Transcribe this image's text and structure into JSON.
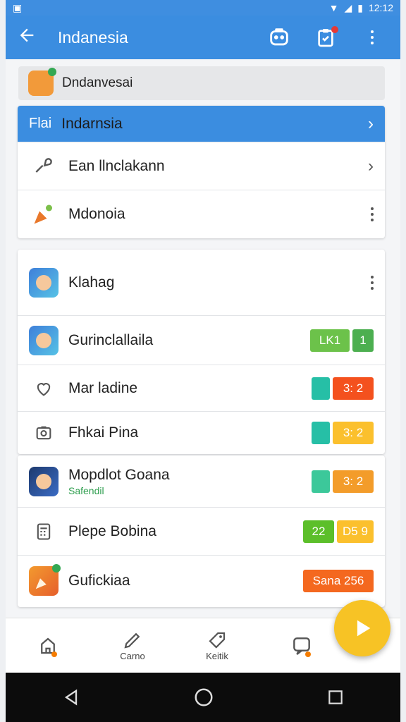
{
  "status_bar": {
    "time": "12:12"
  },
  "app_bar": {
    "title": "Indanesia",
    "back_icon": "arrow-left-icon",
    "actions": [
      "robot-icon",
      "clipboard-icon",
      "more-vert-icon"
    ]
  },
  "search": {
    "value": "Dndanvesai"
  },
  "menu": {
    "highlight": {
      "prefix": "Flai",
      "label": "Indarnsia"
    },
    "items": [
      {
        "label": "Ean llnclakann",
        "icon": "link-icon"
      },
      {
        "label": "Mdonoia",
        "icon": "carrot-icon"
      }
    ]
  },
  "list": [
    {
      "label": "Klahag",
      "icon": "app-icon"
    },
    {
      "label": "Gurinclallaila",
      "icon": "app-icon",
      "badges": [
        {
          "text": "LK1",
          "color": "#6cc24a"
        },
        {
          "text": "1",
          "color": "#4caf50"
        }
      ]
    },
    {
      "label": "Mar ladine",
      "icon": "heart-icon",
      "badges": [
        {
          "text": "",
          "color": "#26bfa6"
        },
        {
          "text": "3: 2",
          "color": "#f4511e"
        }
      ]
    },
    {
      "label": "Fhkai Pina",
      "icon": "camera-icon",
      "badges": [
        {
          "text": "",
          "color": "#26bfa6"
        },
        {
          "text": "3: 2",
          "color": "#fbc02d"
        }
      ]
    },
    {
      "label": "Mopdlot Goana",
      "sublabel": "Safendil",
      "icon": "app-icon",
      "badges": [
        {
          "text": "",
          "color": "#3cc89a"
        },
        {
          "text": "3: 2",
          "color": "#f39c2a"
        }
      ]
    },
    {
      "label": "Plepe Bobina",
      "icon": "calculator-icon",
      "badges": [
        {
          "text": "22",
          "color": "#5cbf2a"
        },
        {
          "text": "D5 9",
          "color": "#fbc02d"
        }
      ]
    },
    {
      "label": "Gufickiaa",
      "icon": "carrot-app-icon",
      "badges": [
        {
          "text": "Sana 256",
          "color": "#f4681f"
        }
      ]
    }
  ],
  "bottom_nav": [
    {
      "label": "",
      "icon": "home-icon"
    },
    {
      "label": "Carno",
      "icon": "pen-icon"
    },
    {
      "label": "Keitik",
      "icon": "tag-icon"
    },
    {
      "label": "",
      "icon": "chat-icon"
    }
  ],
  "fab": {
    "icon": "play-icon"
  },
  "colors": {
    "primary": "#3b8de0",
    "fab": "#f7c325"
  }
}
